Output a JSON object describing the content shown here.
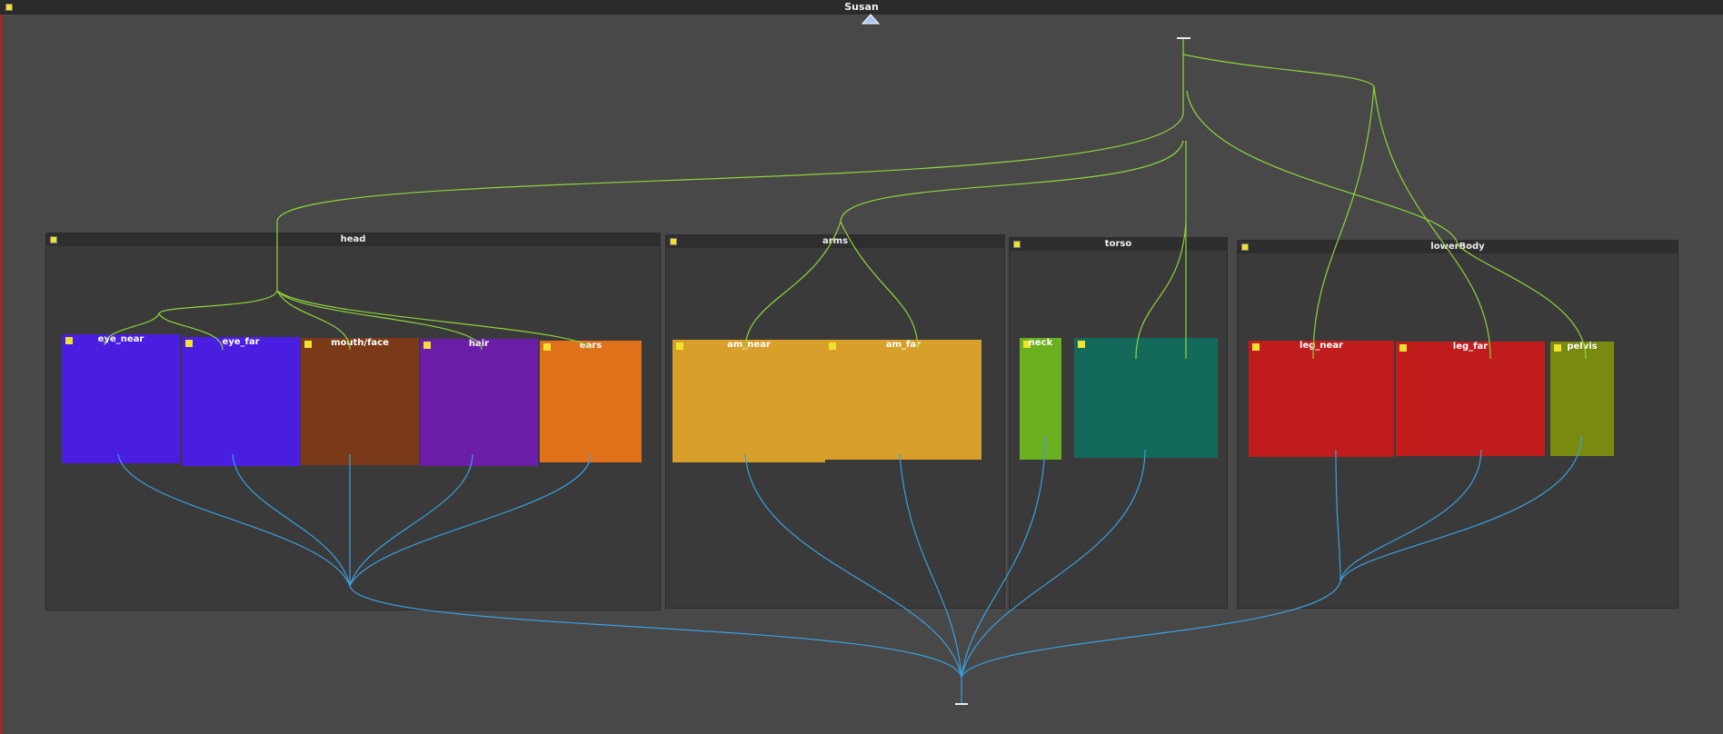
{
  "window": {
    "title": "Susan"
  },
  "groups": {
    "head": "head",
    "arms": "arms",
    "torso": "torso",
    "lowerBody": "lowerBody"
  },
  "subgroups": {
    "eye_near": "eye_near",
    "eye_far": "eye_far",
    "mouth_face": "mouth/face",
    "hair": "hair",
    "ears": "ears",
    "am_near": "am_near",
    "am_far": "am_far",
    "neck": "neck",
    "torso_inner": "",
    "leg_near": "leg_near",
    "leg_far": "leg_far",
    "pelvis": "pelvis"
  },
  "colors": {
    "background": "#484848",
    "group_bg": "#3a3a3a",
    "green_wire": "#8fd43a",
    "blue_wire": "#3aa0e0",
    "eye_near": "#4a1ee0",
    "eye_far": "#4a1ee0",
    "mouth_face": "#7a3a1a",
    "hair": "#6a1ea8",
    "ears": "#e0701a",
    "am_near": "#d8a02a",
    "am_far": "#d8a02a",
    "neck": "#6ab020",
    "torso_inner": "#146a5a",
    "leg_near": "#c01c1c",
    "leg_far": "#c01c1c",
    "pelvis": "#7a8a10"
  },
  "icons": {
    "collapse": "triangle-up-icon",
    "group_marker": "yellow-square-icon"
  }
}
